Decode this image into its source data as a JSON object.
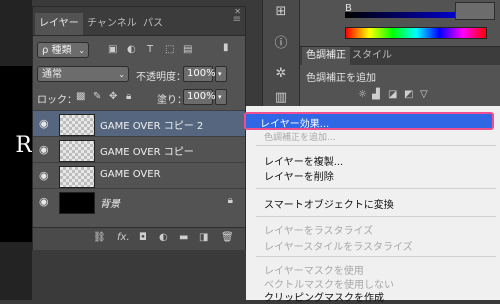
{
  "canvas": {
    "letter": "R"
  },
  "layers_panel": {
    "tabs": [
      "レイヤー",
      "チャンネル",
      "パス"
    ],
    "filter_kind": "ρ 種類",
    "blend_mode": "通常",
    "opacity_label": "不透明度：",
    "opacity_value": "100%",
    "lock_label": "ロック：",
    "fill_label": "塗り：",
    "fill_value": "100%",
    "layers": [
      {
        "name": "GAME OVER コピー 2",
        "selected": true,
        "thumb": "transparent"
      },
      {
        "name": "GAME OVER コピー",
        "selected": false,
        "thumb": "transparent"
      },
      {
        "name": "GAME OVER",
        "selected": false,
        "thumb": "transparent"
      },
      {
        "name": "背景",
        "selected": false,
        "thumb": "black",
        "locked": true
      }
    ]
  },
  "color_panel": {
    "channel_label": "B",
    "value": ""
  },
  "adjustments_panel": {
    "tabs": [
      "色調補正",
      "スタイル"
    ],
    "add_label": "色調補正を追加"
  },
  "context_menu": {
    "highlighted": "レイヤー効果...",
    "partial": "色調補正を追加...",
    "groups": [
      [
        "レイヤーを複製...",
        "レイヤーを削除"
      ],
      [
        "スマートオブジェクトに変換"
      ],
      [
        "レイヤーをラスタライズ",
        "レイヤースタイルをラスタライズ"
      ],
      [
        "レイヤーマスクを使用",
        "ベクトルマスクを使用しない",
        "クリッピングマスクを作成"
      ]
    ]
  },
  "colors": {
    "highlight": "#2f67e5",
    "highlight_border": "#f04f8f",
    "selected_layer": "#55667e"
  }
}
